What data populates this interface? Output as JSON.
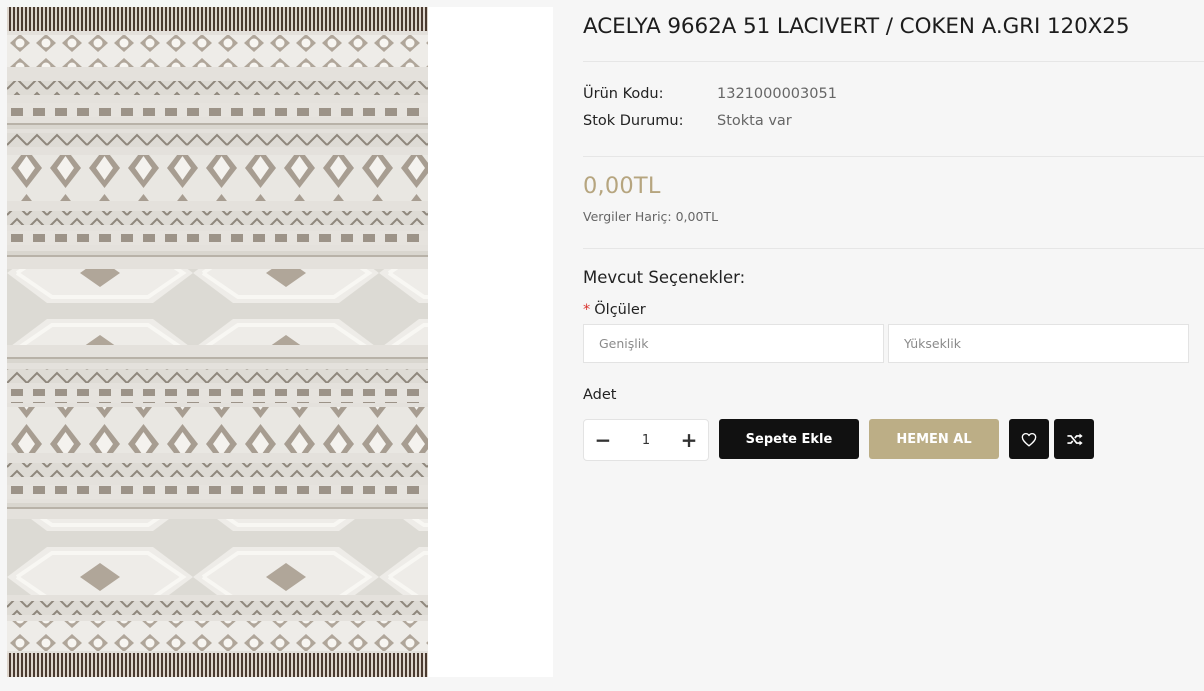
{
  "product": {
    "title": "ACELYA 9662A 51 LACIVERT / COKEN A.GRI 120X25",
    "image_alt": "ACELYA 9662A 51 LACIVERT / COKEN A.GRI 120X25"
  },
  "meta": {
    "code_label": "Ürün Kodu:",
    "code_value": "1321000003051",
    "stock_label": "Stok Durumu:",
    "stock_value": "Stokta var"
  },
  "pricing": {
    "price": "0,00TL",
    "tax_note": "Vergiler Hariç: 0,00TL"
  },
  "options": {
    "title": "Mevcut Seçenekler:",
    "required_mark": "*",
    "field_label": "Ölçüler",
    "width_placeholder": "Genişlik",
    "height_placeholder": "Yükseklik"
  },
  "quantity": {
    "label": "Adet",
    "value": "1",
    "decrement_symbol": "−",
    "increment_symbol": "+"
  },
  "actions": {
    "add_to_cart": "Sepete Ekle",
    "buy_now": "HEMEN AL",
    "wishlist_icon": "heart-icon",
    "compare_icon": "shuffle-icon"
  },
  "colors": {
    "accent_gold": "#b6a57f",
    "buy_button": "#bcae86",
    "dark_button": "#111111",
    "required": "#d9322c"
  }
}
